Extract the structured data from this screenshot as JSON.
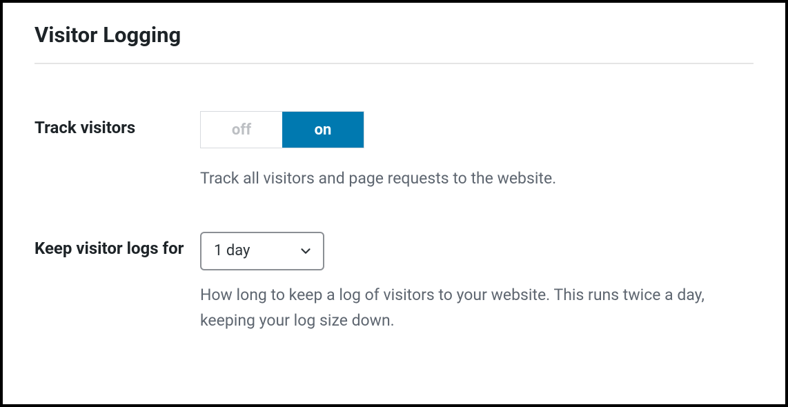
{
  "section": {
    "title": "Visitor Logging"
  },
  "track_visitors": {
    "label": "Track visitors",
    "toggle": {
      "off_label": "off",
      "on_label": "on",
      "selected": "on"
    },
    "description": "Track all visitors and page requests to the website."
  },
  "keep_logs": {
    "label": "Keep visitor logs for",
    "select": {
      "value": "1 day"
    },
    "description": "How long to keep a log of visitors to your website. This runs twice a day, keeping your log size down."
  }
}
